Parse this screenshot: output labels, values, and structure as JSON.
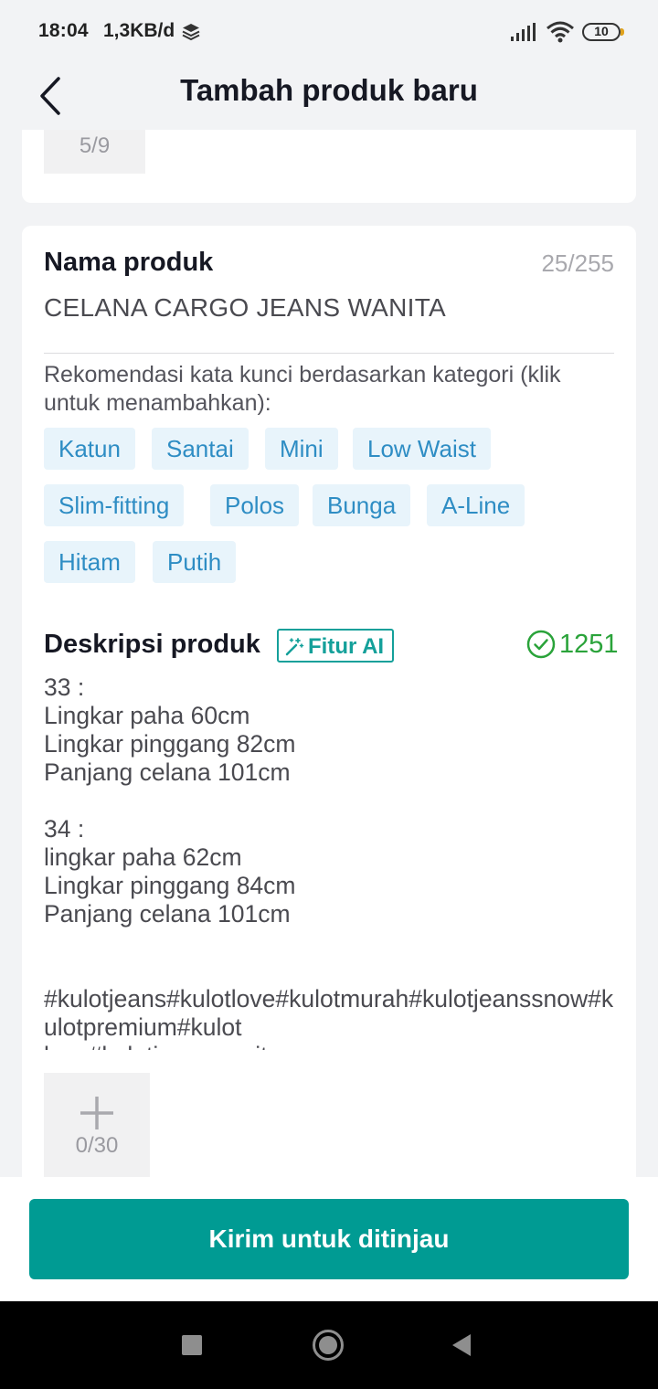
{
  "status_bar": {
    "time": "18:04",
    "speed": "1,3KB/d",
    "battery": "10"
  },
  "header": {
    "title": "Tambah produk baru"
  },
  "media_top": {
    "count": "5/9"
  },
  "product_name": {
    "label": "Nama produk",
    "count": "25/255",
    "value": "CELANA CARGO JEANS WANITA"
  },
  "recommendation": {
    "text": "Rekomendasi kata kunci berdasarkan kategori (klik untuk menambahkan):",
    "chips": [
      "Katun",
      "Santai",
      "Mini",
      "Low Waist",
      "Slim-fitting",
      "Polos",
      "Bunga",
      "A-Line",
      "Hitam",
      "Putih"
    ]
  },
  "description": {
    "label": "Deskripsi produk",
    "ai_label": "Fitur AI",
    "count": "1251",
    "body": "33 :\nLingkar paha 60cm\nLingkar pinggang 82cm\nPanjang celana 101cm\n\n34 :\nlingkar paha 62cm\nLingkar pinggang 84cm\nPanjang celana 101cm\n\n\n#kulotjeans#kulotlove#kulotmurah#kulotjeanssnow#kulotpremium#kulot\nlove#kulotjeanswanita"
  },
  "media_bottom": {
    "count": "0/30"
  },
  "footer": {
    "submit_label": "Kirim untuk ditinjau"
  },
  "colors": {
    "accent": "#009b93",
    "chip_bg": "#e8f4fb",
    "chip_text": "#2e8dc4",
    "success": "#2aa33a"
  },
  "icons": [
    "layers-icon",
    "signal-icon",
    "wifi-icon",
    "battery-icon",
    "back-arrow-icon",
    "magic-wand-icon",
    "check-circle-icon",
    "plus-icon",
    "nav-recents-icon",
    "nav-home-icon",
    "nav-back-icon"
  ]
}
